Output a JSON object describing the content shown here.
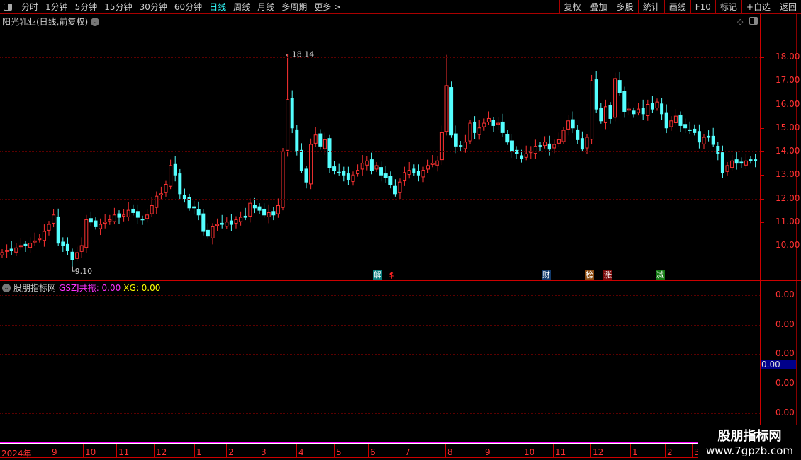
{
  "toolbar": {
    "tabs": [
      "分时",
      "1分钟",
      "5分钟",
      "15分钟",
      "30分钟",
      "60分钟",
      "日线",
      "周线",
      "月线",
      "多周期",
      "更多 >"
    ],
    "active": "日线",
    "right_buttons": [
      "复权",
      "叠加",
      "多股",
      "统计",
      "画线",
      "F10",
      "标记",
      "+自选",
      "返回"
    ]
  },
  "chart_title": "阳光乳业(日线,前复权)",
  "indicator": {
    "name": "股朋指标网",
    "gszj_label": "GSZJ共振: 0.00",
    "xg_label": "XG: 0.00",
    "current_value": "0.00",
    "axis_labels": [
      "0.00",
      "0.00",
      "0.00",
      "0.00",
      "0.00"
    ]
  },
  "signals": [
    {
      "text": "解",
      "color": "#0a7d7d"
    },
    {
      "text": "$",
      "color": "#000"
    },
    {
      "text": "财",
      "color": "#123a6b"
    },
    {
      "text": "榜",
      "color": "#8a4a10"
    },
    {
      "text": "涨",
      "color": "#7a0a0a"
    },
    {
      "text": "减",
      "color": "#137a13"
    }
  ],
  "watermark": {
    "line1": "股朋指标网",
    "line2": "www.7gpzb.com"
  },
  "x_axis": [
    "2024年",
    "9",
    "10",
    "11",
    "12",
    "1",
    "2",
    "3",
    "4",
    "5",
    "6",
    "7",
    "8",
    "9",
    "10",
    "11",
    "12",
    "1",
    "2",
    "3"
  ],
  "chart_data": {
    "type": "candlestick",
    "ylim": [
      9,
      19
    ],
    "y_ticks": [
      "18.00",
      "17.00",
      "16.00",
      "15.00",
      "14.00",
      "13.00",
      "12.00",
      "11.00",
      "10.00"
    ],
    "max_label": "18.14",
    "min_label": "9.10",
    "max_index": 61,
    "min_index": 15,
    "up_color": "#ff3232",
    "down_color": "#54ffff",
    "closes": [
      9.7,
      9.8,
      9.8,
      9.9,
      10.0,
      10.0,
      10.1,
      10.2,
      10.3,
      10.6,
      10.9,
      11.3,
      10.1,
      10.0,
      9.8,
      9.4,
      9.7,
      10.0,
      11.1,
      11.0,
      10.8,
      10.9,
      11.0,
      11.1,
      11.3,
      11.2,
      11.3,
      11.5,
      11.4,
      11.2,
      11.1,
      11.3,
      11.7,
      12.1,
      12.2,
      12.6,
      13.4,
      13.0,
      12.2,
      12.0,
      11.6,
      11.6,
      11.3,
      10.6,
      10.4,
      10.8,
      10.9,
      10.9,
      11.0,
      10.9,
      11.1,
      11.2,
      11.2,
      11.8,
      11.6,
      11.5,
      11.3,
      11.4,
      11.3,
      11.7,
      14.0,
      16.2,
      15.0,
      14.0,
      13.2,
      12.7,
      14.3,
      14.7,
      14.2,
      14.5,
      13.3,
      13.2,
      13.1,
      13.0,
      12.8,
      13.0,
      13.2,
      13.5,
      13.6,
      13.2,
      13.4,
      13.0,
      12.9,
      12.6,
      12.2,
      12.7,
      13.1,
      13.2,
      13.1,
      13.0,
      13.2,
      13.4,
      13.5,
      13.6,
      14.8,
      16.8,
      14.7,
      14.2,
      14.2,
      14.4,
      15.2,
      14.8,
      15.0,
      15.2,
      15.4,
      15.1,
      15.2,
      14.8,
      14.4,
      14.0,
      13.9,
      13.7,
      13.9,
      14.0,
      14.2,
      14.2,
      14.4,
      14.1,
      14.3,
      14.5,
      14.9,
      15.3,
      15.0,
      14.5,
      14.1,
      14.6,
      17.0,
      15.8,
      15.3,
      15.9,
      15.4,
      17.1,
      16.5,
      15.7,
      15.8,
      15.6,
      15.8,
      15.6,
      16.0,
      15.8,
      16.1,
      15.6,
      15.0,
      15.3,
      15.5,
      15.1,
      15.0,
      14.9,
      14.8,
      14.4,
      14.6,
      14.6,
      14.3,
      13.9,
      13.1,
      13.4,
      13.6,
      13.5,
      13.5,
      13.6,
      13.6,
      13.6
    ]
  }
}
